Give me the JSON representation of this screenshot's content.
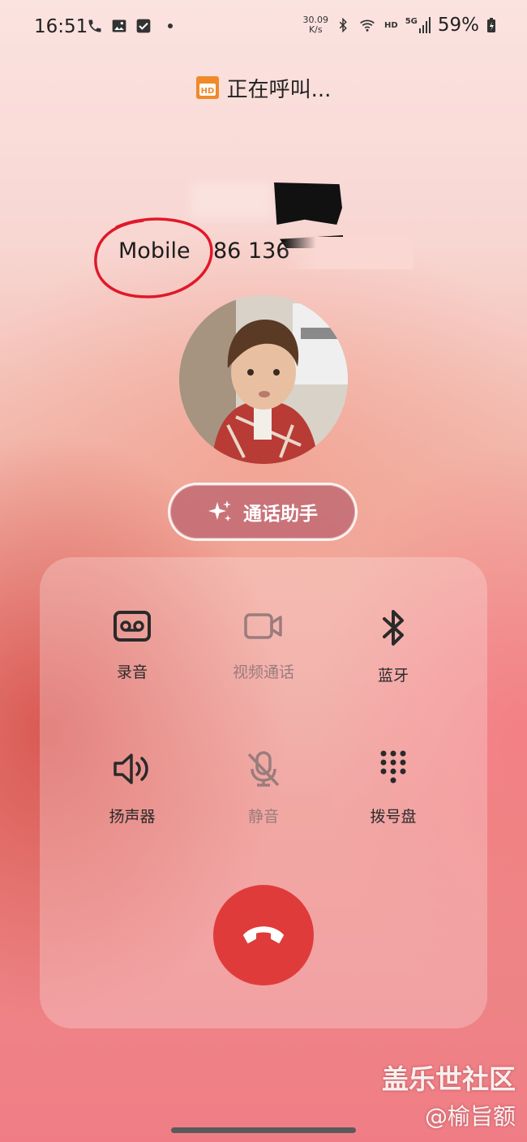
{
  "status_bar": {
    "time": "16:51",
    "net_rate_top": "30.09",
    "net_rate_unit": "K/s",
    "hd_label": "HD",
    "signal_label": "5G",
    "battery": "59%"
  },
  "call": {
    "status_text": "正在呼叫...",
    "number_type": "Mobile",
    "number_partial": "86 136"
  },
  "assistant_button": {
    "label": "通话助手"
  },
  "controls": {
    "record": {
      "label": "录音",
      "enabled": true
    },
    "video_call": {
      "label": "视频通话",
      "enabled": false
    },
    "bluetooth": {
      "label": "蓝牙",
      "enabled": true
    },
    "speaker": {
      "label": "扬声器",
      "enabled": true
    },
    "mute": {
      "label": "静音",
      "enabled": false
    },
    "keypad": {
      "label": "拨号盘",
      "enabled": true
    }
  },
  "watermark": {
    "site": "盖乐世社区",
    "user": "@榆旨额"
  },
  "colors": {
    "end_call": "#e03b3b",
    "annotation_circle": "#e0182a",
    "hd_badge": "#f08a2a"
  }
}
